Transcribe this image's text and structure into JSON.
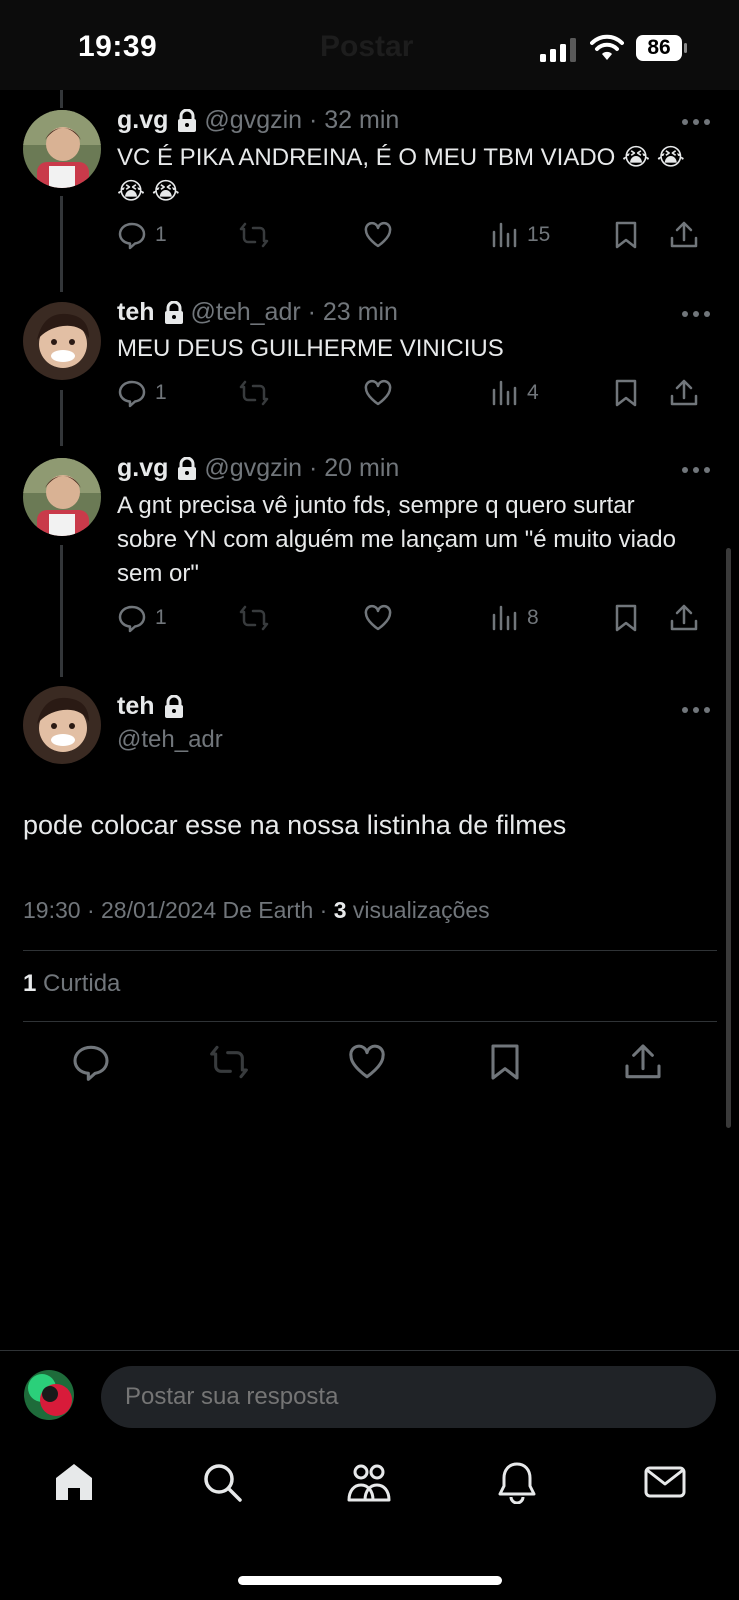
{
  "status_bar": {
    "time": "19:39",
    "battery": "86",
    "header_ghost": "Postar"
  },
  "thread": [
    {
      "name": "g.vg",
      "handle": "@gvgzin · 32 min",
      "text": "VC É PIKA ANDREINA, É O MEU TBM VIADO 😭 😭 😭 😭",
      "replies": "1",
      "views": "15",
      "avatar_icon": "toddler-avatar"
    },
    {
      "name": "teh",
      "handle": "@teh_adr · 23 min",
      "text": "MEU DEUS GUILHERME VINICIUS",
      "replies": "1",
      "views": "4",
      "avatar_icon": "child-avatar"
    },
    {
      "name": "g.vg",
      "handle": "@gvgzin · 20 min",
      "text": "A gnt precisa vê junto fds, sempre q quero surtar sobre YN com alguém me lançam um \"é muito viado sem or\"",
      "replies": "1",
      "views": "8",
      "avatar_icon": "toddler-avatar"
    }
  ],
  "main_tweet": {
    "name": "teh",
    "handle": "@teh_adr",
    "text": "pode colocar esse na nossa listinha de filmes",
    "meta_prefix": "19:30 · 28/01/2024 De Earth · ",
    "views_count": "3",
    "views_label": " visualizações",
    "likes_count": "1",
    "likes_label": " Curtida"
  },
  "reply": {
    "placeholder": "Postar sua resposta"
  },
  "colors": {
    "background": "#000000",
    "text": "#e7e9ea",
    "muted": "#71767b",
    "divider": "#2f3336"
  }
}
